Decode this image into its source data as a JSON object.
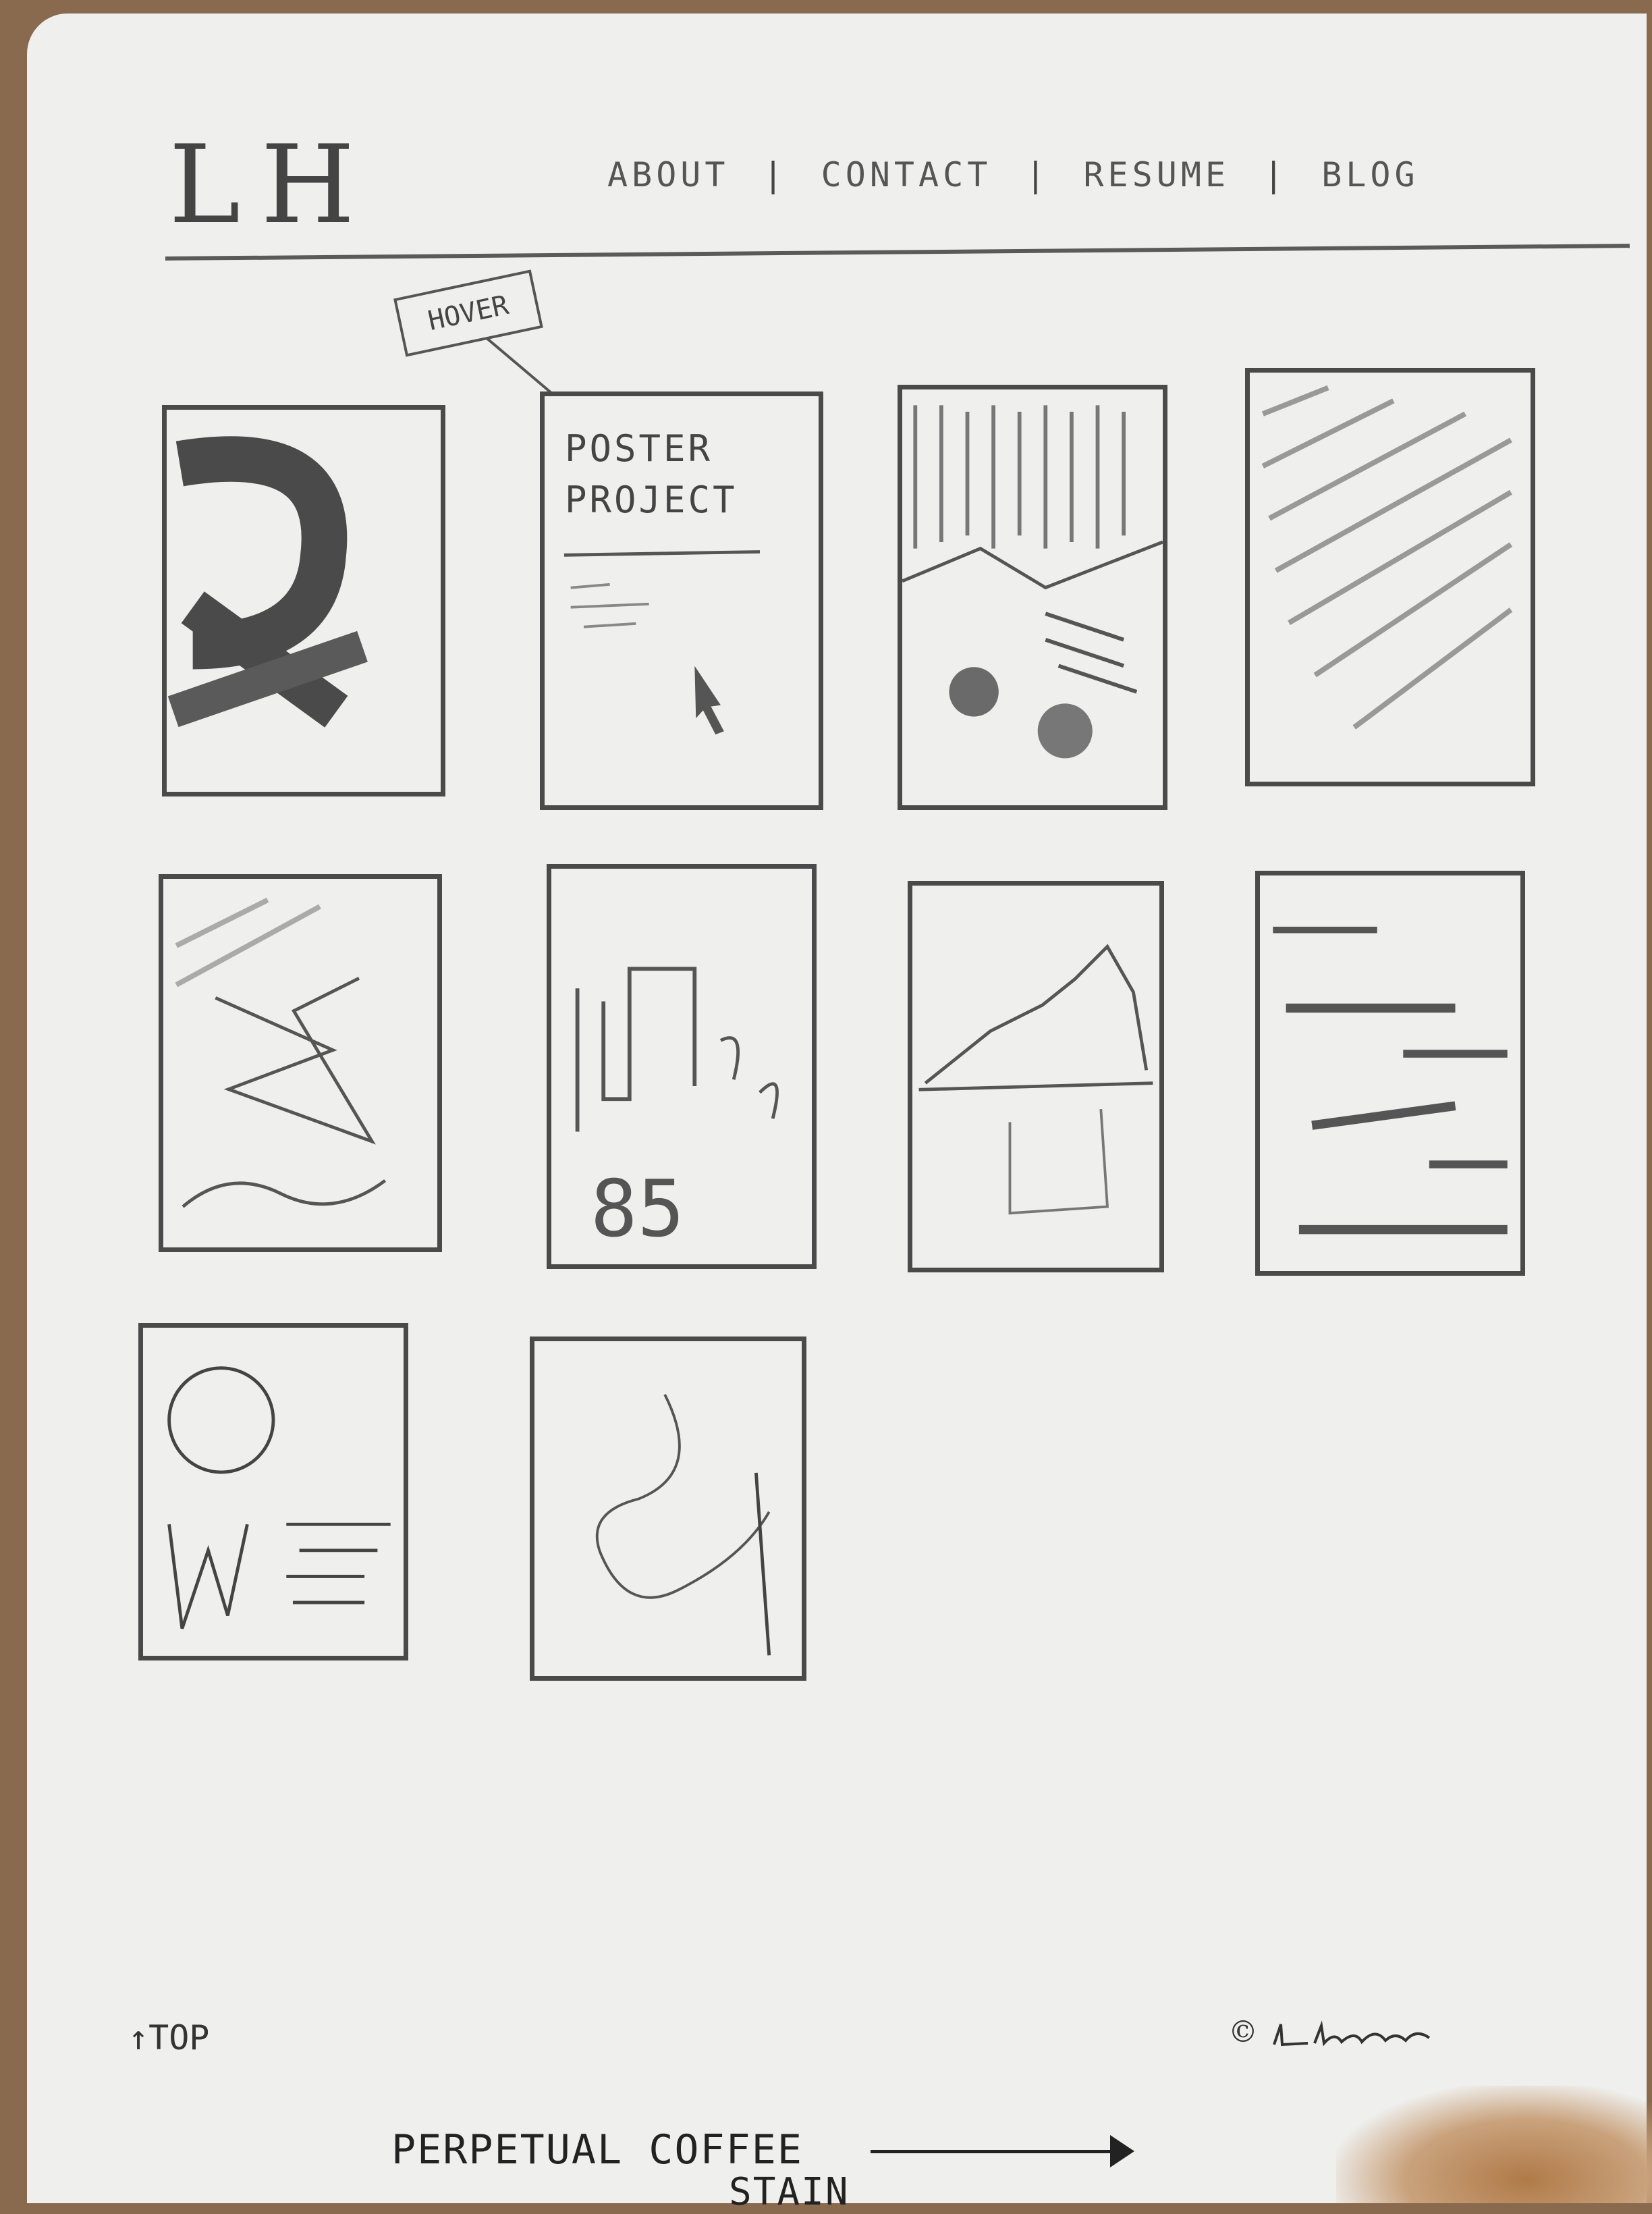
{
  "header": {
    "logo": "LH",
    "nav": [
      {
        "label": "ABOUT"
      },
      {
        "label": "CONTACT"
      },
      {
        "label": "RESUME"
      },
      {
        "label": "BLOG"
      }
    ],
    "separator": "|"
  },
  "annotation": {
    "hover_tag": "HOVER"
  },
  "grid": {
    "featured_tile": {
      "title_line1": "POSTER",
      "title_line2": "PROJECT"
    }
  },
  "footer": {
    "top_link": "↑TOP",
    "copyright_symbol": "©"
  },
  "margin_note": {
    "line1": "PERPETUAL COFFEE",
    "line2": "STAIN"
  }
}
